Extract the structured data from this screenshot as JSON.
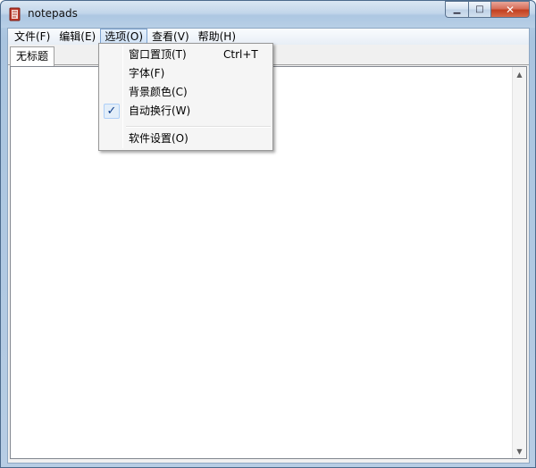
{
  "window": {
    "title": "notepads"
  },
  "menubar": {
    "items": [
      {
        "label": "文件(F)"
      },
      {
        "label": "编辑(E)"
      },
      {
        "label": "选项(O)"
      },
      {
        "label": "查看(V)"
      },
      {
        "label": "帮助(H)"
      }
    ],
    "active_index": 2
  },
  "tabs": [
    {
      "label": "无标题"
    }
  ],
  "editor": {
    "content": ""
  },
  "options_menu": {
    "items": [
      {
        "label": "窗口置顶(T)",
        "shortcut": "Ctrl+T",
        "checked": false
      },
      {
        "label": "字体(F)",
        "shortcut": "",
        "checked": false
      },
      {
        "label": "背景颜色(C)",
        "shortcut": "",
        "checked": false
      },
      {
        "label": "自动换行(W)",
        "shortcut": "",
        "checked": true
      },
      {
        "label": "软件设置(O)",
        "shortcut": "",
        "checked": false
      }
    ],
    "check_glyph": "✓"
  },
  "colors": {
    "accent": "#7da2ce",
    "close_button": "#c2401f",
    "check": "#0c3c8a"
  }
}
